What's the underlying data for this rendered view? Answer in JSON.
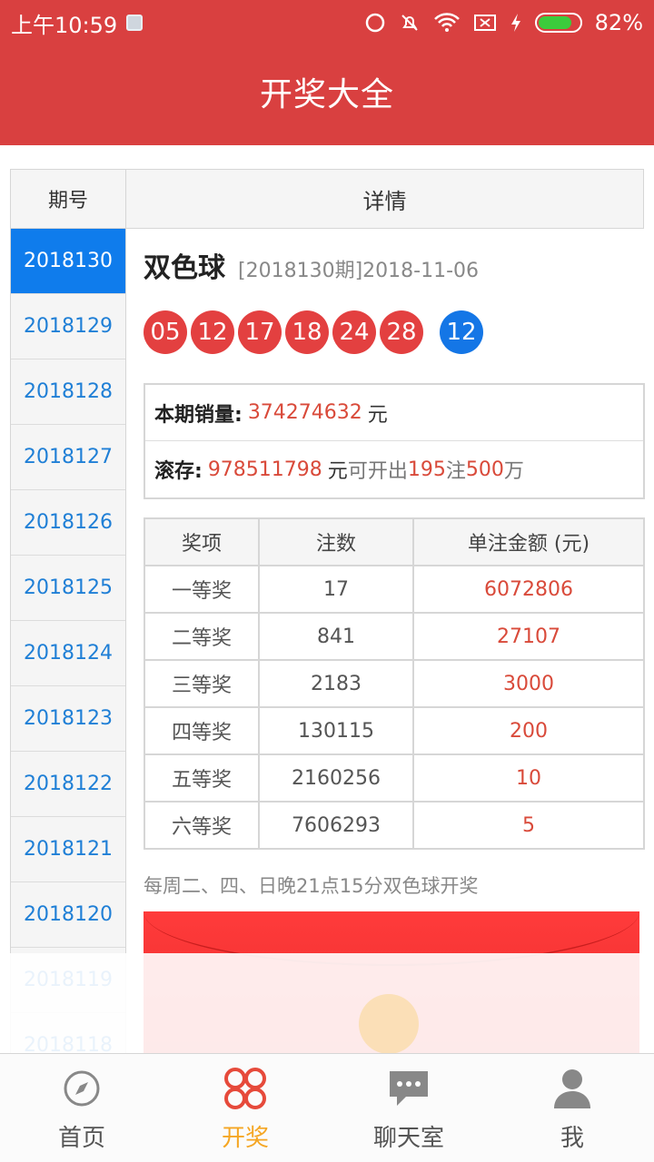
{
  "status_bar": {
    "time": "上午10:59",
    "battery": "82%",
    "battery_level": 0.82
  },
  "header": {
    "title": "开奖大全"
  },
  "left": {
    "header": "期号",
    "periods": [
      "2018130",
      "2018129",
      "2018128",
      "2018127",
      "2018126",
      "2018125",
      "2018124",
      "2018123",
      "2018122",
      "2018121",
      "2018120",
      "2018119",
      "2018118"
    ],
    "active_index": 0
  },
  "detail": {
    "header": "详情",
    "game_name": "双色球",
    "issue": "[2018130期]2018-11-06",
    "red_balls": [
      "05",
      "12",
      "17",
      "18",
      "24",
      "28"
    ],
    "blue_ball": "12",
    "sales_label": "本期销量:",
    "sales_value": "374274632",
    "sales_unit": "元",
    "pool_label": "滚存:",
    "pool_value": "978511798",
    "pool_unit": "元",
    "pool_text1": "可开出",
    "pool_count": "195",
    "pool_text2": "注",
    "pool_amount": "500",
    "pool_text3": "万",
    "table_headers": [
      "奖项",
      "注数",
      "单注金额 (元)"
    ],
    "prizes": [
      {
        "name": "一等奖",
        "count": "17",
        "amount": "6072806"
      },
      {
        "name": "二等奖",
        "count": "841",
        "amount": "27107"
      },
      {
        "name": "三等奖",
        "count": "2183",
        "amount": "3000"
      },
      {
        "name": "四等奖",
        "count": "130115",
        "amount": "200"
      },
      {
        "name": "五等奖",
        "count": "2160256",
        "amount": "10"
      },
      {
        "name": "六等奖",
        "count": "7606293",
        "amount": "5"
      }
    ],
    "note": "每周二、四、日晚21点15分双色球开奖"
  },
  "nav": [
    {
      "label": "首页",
      "icon": "compass-icon"
    },
    {
      "label": "开奖",
      "icon": "clover-icon"
    },
    {
      "label": "聊天室",
      "icon": "chat-icon"
    },
    {
      "label": "我",
      "icon": "user-icon"
    }
  ],
  "colors": {
    "header_red": "#d94040",
    "active_blue": "#0f7cec",
    "nav_active": "#f5a623"
  }
}
